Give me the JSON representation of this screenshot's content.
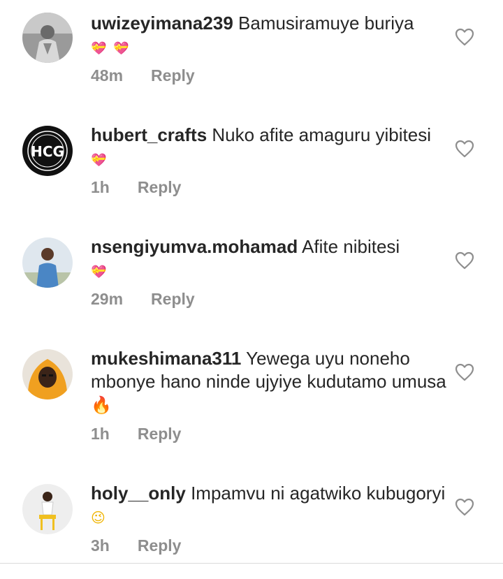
{
  "comments": [
    {
      "username": "uwizeyimana239",
      "text": "Bamusiramuye buriya",
      "emoji": "💝 💝",
      "time": "48m",
      "reply_label": "Reply"
    },
    {
      "username": "hubert_crafts",
      "text": "Nuko afite amaguru yibitesi",
      "emoji": "💝",
      "time": "1h",
      "reply_label": "Reply"
    },
    {
      "username": "nsengiyumva.mohamad",
      "text": "Afite nibitesi",
      "emoji": "💝",
      "time": "29m",
      "reply_label": "Reply"
    },
    {
      "username": "mukeshimana311",
      "text": "Yewega uyu noneho mbonye hano ninde ujyiye kudutamo umusa",
      "emoji": "🔥",
      "time": "1h",
      "reply_label": "Reply"
    },
    {
      "username": "holy__only",
      "text": "Impamvu ni agatwiko kubugoryi",
      "emoji": "😉",
      "time": "3h",
      "reply_label": "Reply"
    }
  ],
  "icons": {
    "like": "heart-outline-icon"
  },
  "colors": {
    "text": "#262626",
    "secondary": "#8e8e8e",
    "emoji_pink": "#e040c8",
    "fire": "#e8261b"
  }
}
